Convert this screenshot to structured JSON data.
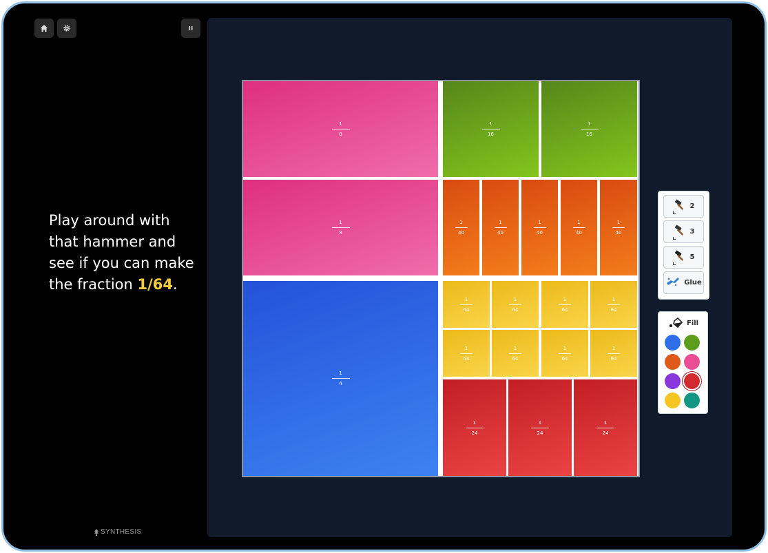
{
  "prompt": {
    "text": "Play around with that hammer and see if you can make the fraction ",
    "highlight": "1/64",
    "end": "."
  },
  "brand": {
    "name": "SYNTHESIS"
  },
  "icons": {
    "home": "home-icon",
    "settings": "gear-icon",
    "pause": "pause-icon"
  },
  "tiles": [
    {
      "num": "1",
      "den": "8"
    },
    {
      "num": "1",
      "den": "16"
    },
    {
      "num": "1",
      "den": "16"
    },
    {
      "num": "1",
      "den": "8"
    },
    {
      "num": "1",
      "den": "40"
    },
    {
      "num": "1",
      "den": "40"
    },
    {
      "num": "1",
      "den": "40"
    },
    {
      "num": "1",
      "den": "40"
    },
    {
      "num": "1",
      "den": "40"
    },
    {
      "num": "1",
      "den": "4"
    },
    {
      "num": "1",
      "den": "64"
    },
    {
      "num": "1",
      "den": "64"
    },
    {
      "num": "1",
      "den": "64"
    },
    {
      "num": "1",
      "den": "64"
    },
    {
      "num": "1",
      "den": "64"
    },
    {
      "num": "1",
      "den": "64"
    },
    {
      "num": "1",
      "den": "64"
    },
    {
      "num": "1",
      "den": "64"
    },
    {
      "num": "1",
      "den": "24"
    },
    {
      "num": "1",
      "den": "24"
    },
    {
      "num": "1",
      "den": "24"
    }
  ],
  "tools": [
    {
      "label": "2",
      "icon": "hammer-icon"
    },
    {
      "label": "3",
      "icon": "hammer-icon"
    },
    {
      "label": "5",
      "icon": "hammer-icon"
    },
    {
      "label": "Glue",
      "icon": "glue-icon"
    }
  ],
  "fill": {
    "label": "Fill",
    "icon": "paint-bucket-icon"
  },
  "colors": {
    "blue": "#2f6ee6",
    "green": "#5c9e1c",
    "orange": "#e0581a",
    "pink": "#ea4f95",
    "purple": "#8a36dd",
    "red": "#d12a2f",
    "yellow": "#f5c623",
    "teal": "#139683",
    "selected": "red"
  }
}
